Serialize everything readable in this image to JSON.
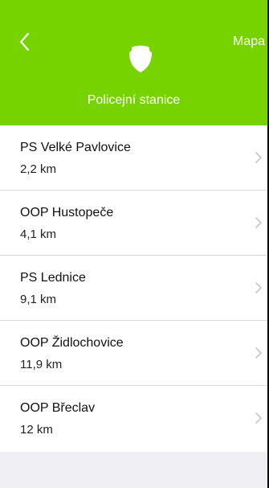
{
  "header": {
    "title": "Policejní stanice",
    "map_label": "Mapa",
    "back_icon": "chevron-left-icon",
    "logo_icon": "police-shield-icon",
    "background_color": "#77d300"
  },
  "stations": [
    {
      "name": "PS Velké Pavlovice",
      "distance": "2,2 km"
    },
    {
      "name": "OOP Hustopeče",
      "distance": "4,1 km"
    },
    {
      "name": "PS Lednice",
      "distance": "9,1 km"
    },
    {
      "name": "OOP Židlochovice",
      "distance": "11,9 km"
    },
    {
      "name": "OOP Břeclav",
      "distance": "12 km"
    }
  ]
}
